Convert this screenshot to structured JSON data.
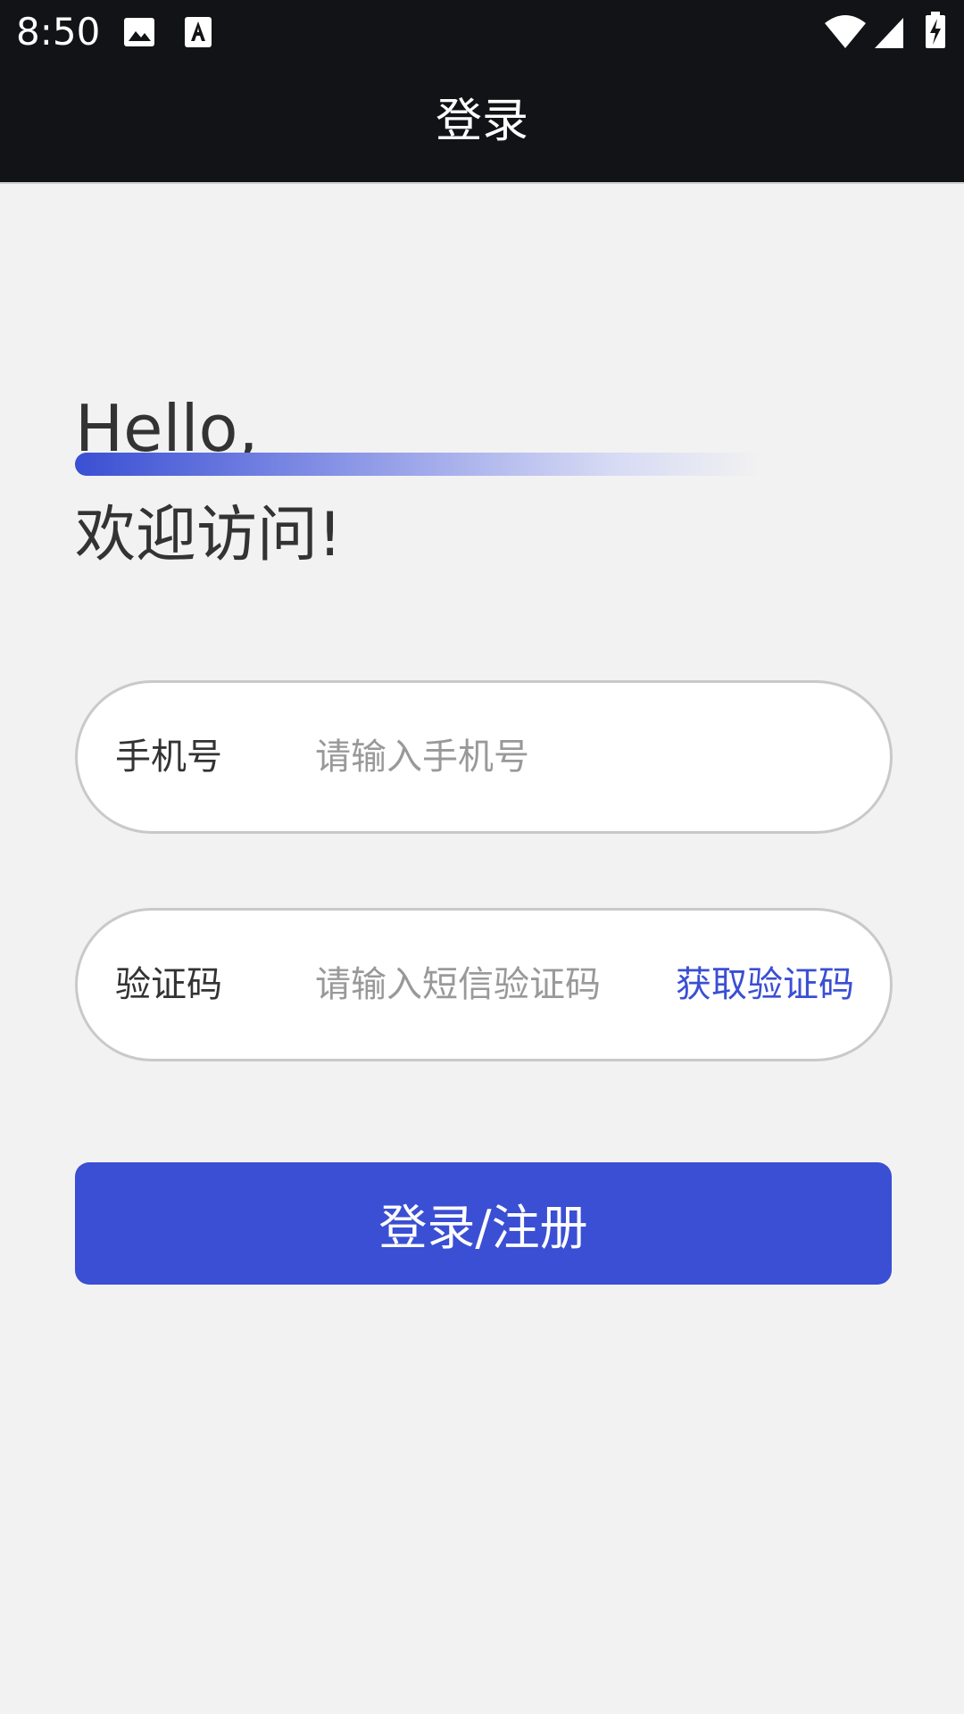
{
  "status_bar": {
    "time": "8:50",
    "icons": [
      "image-icon",
      "text-a-icon",
      "wifi-icon",
      "cell-signal-icon",
      "battery-charging-icon"
    ]
  },
  "app_bar": {
    "title": "登录"
  },
  "greeting": {
    "hello": "Hello,",
    "welcome": "欢迎访问!"
  },
  "form": {
    "phone": {
      "label": "手机号",
      "placeholder": "请输入手机号",
      "value": ""
    },
    "code": {
      "label": "验证码",
      "placeholder": "请输入短信验证码",
      "value": "",
      "get_code_label": "获取验证码"
    },
    "submit_label": "登录/注册"
  },
  "colors": {
    "accent": "#3a4fd3",
    "top_bar": "#121316",
    "background": "#f2f2f2",
    "field_border": "#c9c9c9",
    "placeholder": "#999999",
    "text": "#333333"
  }
}
